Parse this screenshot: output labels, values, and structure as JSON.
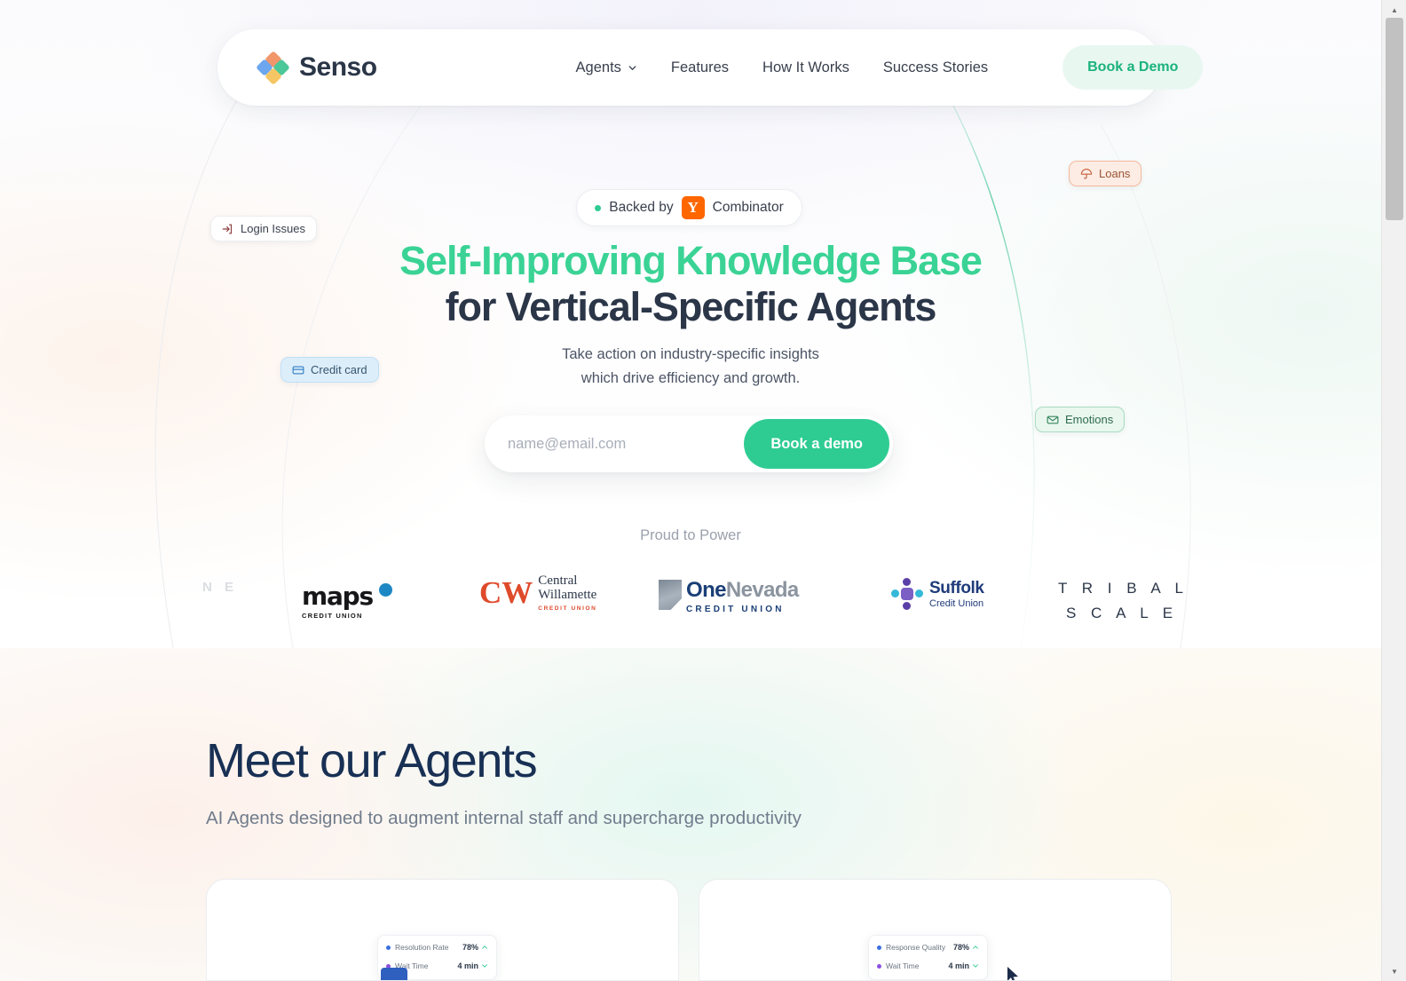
{
  "brand": {
    "name": "Senso",
    "logo_icon": "senso-diamond-logo",
    "colors": {
      "top": "#f2956b",
      "left": "#6ca6ee",
      "right": "#4cc79a",
      "bottom": "#f5c663"
    }
  },
  "nav": {
    "links": [
      {
        "label": "Agents",
        "has_caret": true
      },
      {
        "label": "Features",
        "has_caret": false
      },
      {
        "label": "How It Works",
        "has_caret": false
      },
      {
        "label": "Success Stories",
        "has_caret": false
      }
    ],
    "cta": {
      "label": "Book a Demo",
      "color": "#19b37b",
      "bg": "#e9f7f1"
    }
  },
  "hero": {
    "badge": {
      "prefix": "Backed by",
      "logo_letter": "Y",
      "suffix": "Combinator",
      "dot_color": "#2ecc93",
      "logo_bg": "#ff6600"
    },
    "headline_line1": "Self-Improving Knowledge Base",
    "headline_line2": "for Vertical-Specific Agents",
    "headline_line1_color": "#3ad395",
    "headline_line2_color": "#2b3648",
    "subhead_line1": "Take action on industry-specific insights",
    "subhead_line2": "which drive efficiency and growth.",
    "form": {
      "email_placeholder": "name@email.com",
      "email_value": "",
      "submit_label": "Book a demo",
      "submit_color": "#2ecc93"
    },
    "chips": [
      {
        "label": "Login Issues",
        "icon": "login-icon",
        "bg": "#ffffff",
        "border": "#ecedef",
        "fg": "#8a3b3b"
      },
      {
        "label": "Credit card",
        "icon": "credit-card-icon",
        "bg": "#ddeefb",
        "border": "#bfdff6",
        "fg": "#2f7fc4"
      },
      {
        "label": "Loans",
        "icon": "umbrella-icon",
        "bg": "#fcece4",
        "border": "#f3b99c",
        "fg": "#c4603a"
      },
      {
        "label": "Emotions",
        "icon": "envelope-icon",
        "bg": "#e9f7ef",
        "border": "#a9dcc1",
        "fg": "#35865c"
      }
    ]
  },
  "social_proof": {
    "heading": "Proud to Power",
    "logos": [
      {
        "name": "ne-partial-logo",
        "primary": "N E",
        "sub": ""
      },
      {
        "name": "maps-credit-union",
        "primary": "maps",
        "sub": "CREDIT UNION"
      },
      {
        "name": "central-willamette",
        "line1": "Central",
        "line2": "Willamette",
        "sub": "CREDIT UNION",
        "mark": "CW"
      },
      {
        "name": "one-nevada",
        "primary": "One",
        "secondary": "Nevada",
        "sub": "C R E D I T  U N I O N"
      },
      {
        "name": "suffolk-credit-union",
        "primary": "Suffolk",
        "sub": "Credit Union"
      },
      {
        "name": "tribal-scale",
        "line1": "T R I B A L",
        "line2": "S C A L E"
      }
    ]
  },
  "agents": {
    "title": "Meet our Agents",
    "subtitle": "AI Agents designed to augment internal staff and supercharge productivity",
    "cards": [
      {
        "name": "agent-card-1",
        "metrics": [
          {
            "label": "Resolution Rate",
            "value": "78%",
            "trend": "up",
            "dot": "blue"
          },
          {
            "label": "Wait Time",
            "value": "4 min",
            "trend": "down",
            "dot": "purple"
          }
        ]
      },
      {
        "name": "agent-card-2",
        "metrics": [
          {
            "label": "Response Quality",
            "value": "78%",
            "trend": "up",
            "dot": "blue"
          },
          {
            "label": "Wait Time",
            "value": "4 min",
            "trend": "down",
            "dot": "purple"
          }
        ]
      }
    ]
  },
  "scrollbar": {
    "up_arrow": "▲",
    "down_arrow": "▼"
  }
}
